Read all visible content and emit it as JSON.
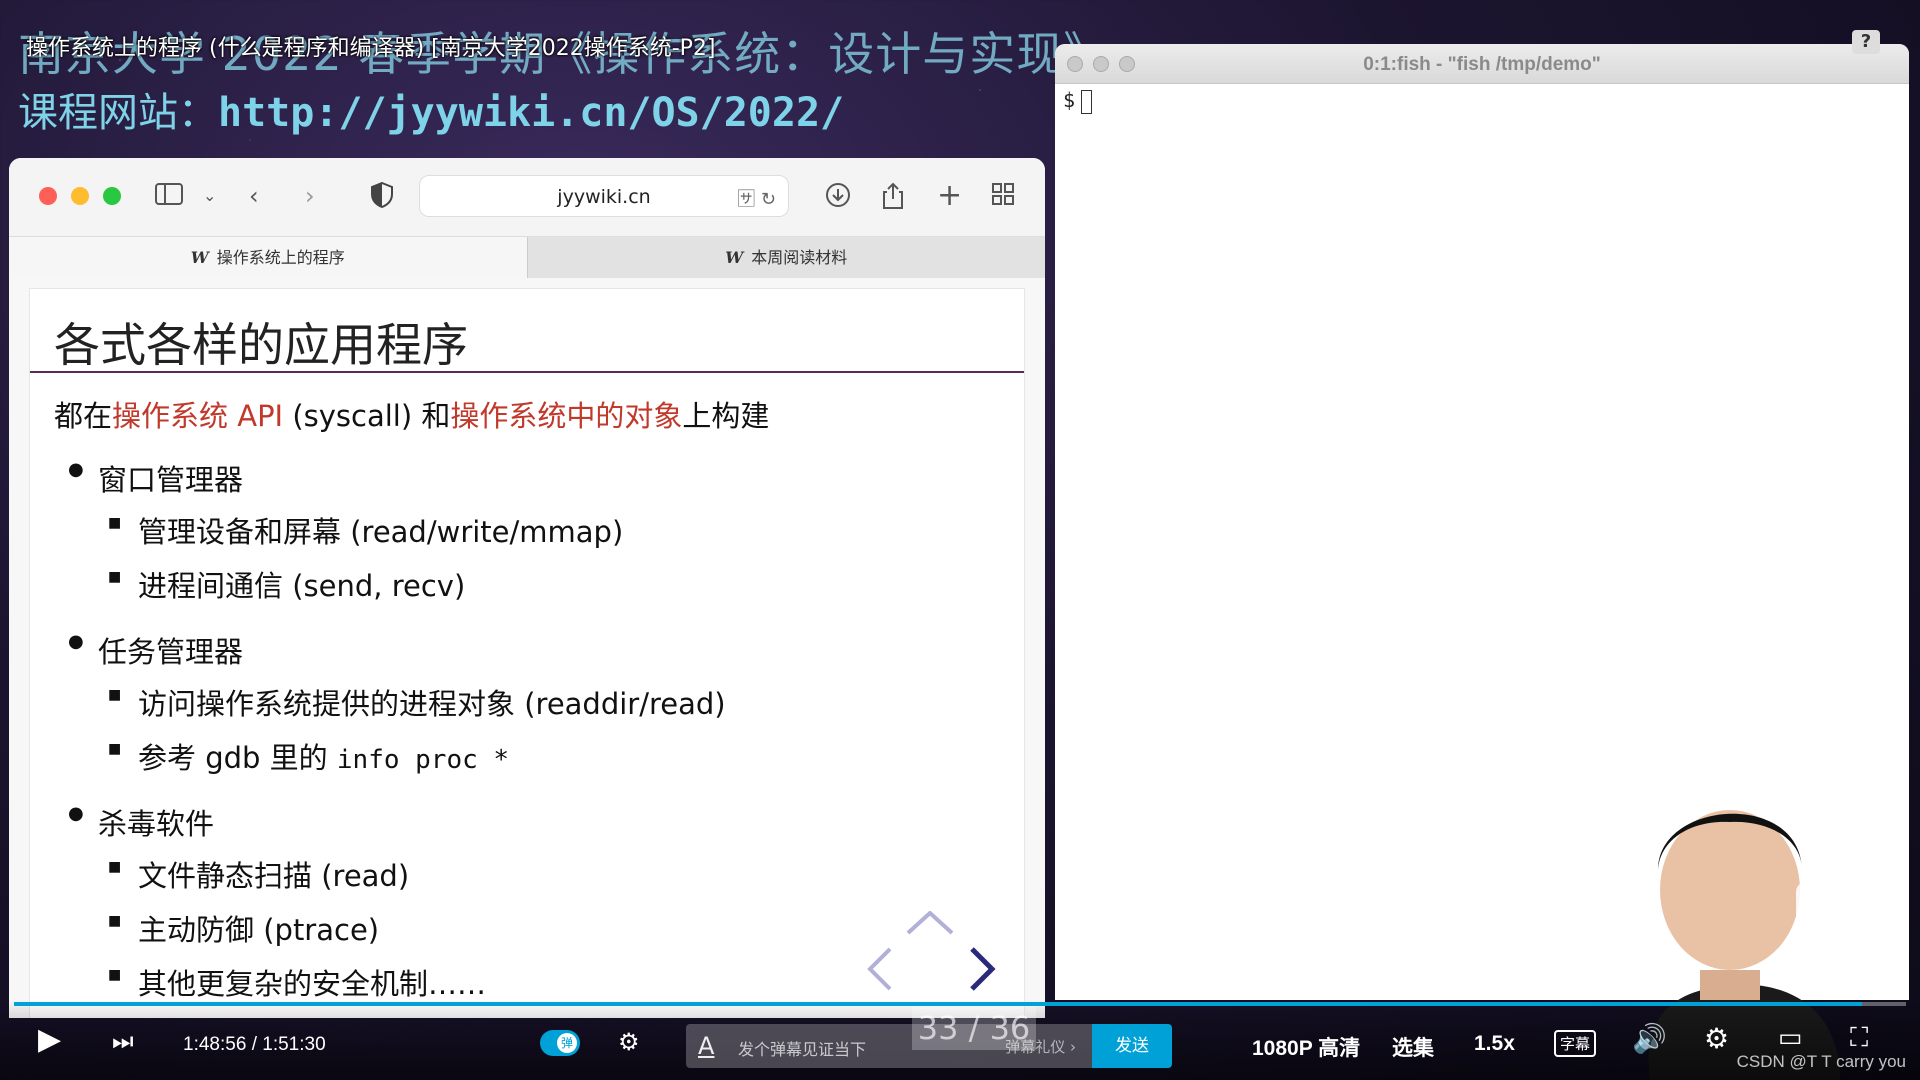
{
  "video": {
    "title": "操作系统上的程序 (什么是程序和编译器) [南京大学2022操作系统-P2]",
    "course_title": "南京大学 2022 春季学期《操作系统：设计与实现》",
    "course_site_label": "课程网站：",
    "course_site_url": "http://jyywiki.cn/OS/2022/"
  },
  "browser": {
    "address": "jyywiki.cn",
    "tabs": [
      {
        "icon": "W",
        "label": "操作系统上的程序",
        "active": true
      },
      {
        "icon": "W",
        "label": "本周阅读材料",
        "active": false
      }
    ]
  },
  "slide": {
    "title": "各式各样的应用程序",
    "lead_prefix": "都在",
    "lead_red1": "操作系统 API",
    "lead_mid": " (syscall) 和",
    "lead_red2": "操作系统中的对象",
    "lead_suffix": "上构建",
    "sections": [
      {
        "heading": "窗口管理器",
        "items": [
          "管理设备和屏幕 (read/write/mmap)",
          "进程间通信 (send, recv)"
        ]
      },
      {
        "heading": "任务管理器",
        "items": [
          "访问操作系统提供的进程对象 (readdir/read)"
        ],
        "gdb_prefix": "参考 gdb 里的 ",
        "gdb_code": "info proc *"
      },
      {
        "heading": "杀毒软件",
        "items": [
          "文件静态扫描 (read)",
          "主动防御 (ptrace)",
          "其他更复杂的安全机制……"
        ]
      }
    ]
  },
  "terminal": {
    "title": "0:1:fish - \"fish /tmp/demo\"",
    "prompt": "$"
  },
  "player": {
    "current_time": "1:48:56",
    "separator": "/",
    "duration": "1:51:30",
    "progress_fraction": 0.977,
    "danmaku_toggle": "弹",
    "danmaku_placeholder": "发个弹幕见证当下",
    "danmaku_etiquette": "弹幕礼仪 ›",
    "send_label": "发送",
    "page_indicator": "33 / 36",
    "quality": "1080P 高清",
    "episodes": "选集",
    "speed": "1.5x",
    "subtitle": "字幕",
    "watermark": "CSDN @T T carry you",
    "accent": "#00a1d6"
  }
}
